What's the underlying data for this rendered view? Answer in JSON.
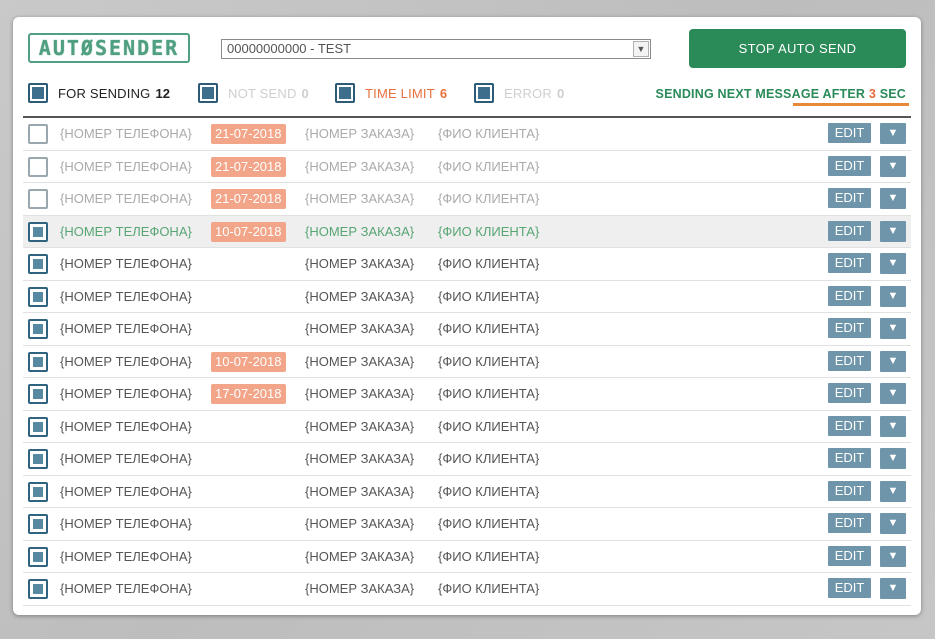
{
  "header": {
    "logo_text": "AUTØSENDER",
    "account_select": "00000000000 - TEST",
    "stop_button": "STOP AUTO SEND"
  },
  "filters": [
    {
      "label": "FOR SENDING",
      "count": "12",
      "color": "#222222",
      "count_color": "#222222"
    },
    {
      "label": "NOT SEND",
      "count": "0",
      "color": "#cfcfcf",
      "count_color": "#cfcfcf"
    },
    {
      "label": "TIME LIMIT",
      "count": "6",
      "color": "#e8703e",
      "count_color": "#e8703e"
    },
    {
      "label": "ERROR",
      "count": "0",
      "color": "#cfcfcf",
      "count_color": "#cfcfcf"
    }
  ],
  "sending_info": {
    "prefix": "SENDING NEXT MESSAGE AFTER",
    "seconds": "3",
    "suffix": "SEC"
  },
  "buttons": {
    "edit": "EDIT",
    "dropdown_icon": "▼"
  },
  "rows": [
    {
      "checked": false,
      "style": "grey",
      "phone": "{НОМЕР ТЕЛЕФОНА}",
      "date": "21-07-2018",
      "order": "{НОМЕР ЗАКАЗА}",
      "client": "{ФИО КЛИЕНТА}"
    },
    {
      "checked": false,
      "style": "grey",
      "phone": "{НОМЕР ТЕЛЕФОНА}",
      "date": "21-07-2018",
      "order": "{НОМЕР ЗАКАЗА}",
      "client": "{ФИО КЛИЕНТА}"
    },
    {
      "checked": false,
      "style": "grey",
      "phone": "{НОМЕР ТЕЛЕФОНА}",
      "date": "21-07-2018",
      "order": "{НОМЕР ЗАКАЗА}",
      "client": "{ФИО КЛИЕНТА}"
    },
    {
      "checked": true,
      "style": "green",
      "phone": "{НОМЕР ТЕЛЕФОНА}",
      "date": "10-07-2018",
      "order": "{НОМЕР ЗАКАЗА}",
      "client": "{ФИО КЛИЕНТА}"
    },
    {
      "checked": true,
      "style": "normal",
      "phone": "{НОМЕР ТЕЛЕФОНА}",
      "date": "",
      "order": "{НОМЕР ЗАКАЗА}",
      "client": "{ФИО КЛИЕНТА}"
    },
    {
      "checked": true,
      "style": "normal",
      "phone": "{НОМЕР ТЕЛЕФОНА}",
      "date": "",
      "order": "{НОМЕР ЗАКАЗА}",
      "client": "{ФИО КЛИЕНТА}"
    },
    {
      "checked": true,
      "style": "normal",
      "phone": "{НОМЕР ТЕЛЕФОНА}",
      "date": "",
      "order": "{НОМЕР ЗАКАЗА}",
      "client": "{ФИО КЛИЕНТА}"
    },
    {
      "checked": true,
      "style": "normal",
      "phone": "{НОМЕР ТЕЛЕФОНА}",
      "date": "10-07-2018",
      "order": "{НОМЕР ЗАКАЗА}",
      "client": "{ФИО КЛИЕНТА}"
    },
    {
      "checked": true,
      "style": "normal",
      "phone": "{НОМЕР ТЕЛЕФОНА}",
      "date": "17-07-2018",
      "order": "{НОМЕР ЗАКАЗА}",
      "client": "{ФИО КЛИЕНТА}"
    },
    {
      "checked": true,
      "style": "normal",
      "phone": "{НОМЕР ТЕЛЕФОНА}",
      "date": "",
      "order": "{НОМЕР ЗАКАЗА}",
      "client": "{ФИО КЛИЕНТА}"
    },
    {
      "checked": true,
      "style": "normal",
      "phone": "{НОМЕР ТЕЛЕФОНА}",
      "date": "",
      "order": "{НОМЕР ЗАКАЗА}",
      "client": "{ФИО КЛИЕНТА}"
    },
    {
      "checked": true,
      "style": "normal",
      "phone": "{НОМЕР ТЕЛЕФОНА}",
      "date": "",
      "order": "{НОМЕР ЗАКАЗА}",
      "client": "{ФИО КЛИЕНТА}"
    },
    {
      "checked": true,
      "style": "normal",
      "phone": "{НОМЕР ТЕЛЕФОНА}",
      "date": "",
      "order": "{НОМЕР ЗАКАЗА}",
      "client": "{ФИО КЛИЕНТА}"
    },
    {
      "checked": true,
      "style": "normal",
      "phone": "{НОМЕР ТЕЛЕФОНА}",
      "date": "",
      "order": "{НОМЕР ЗАКАЗА}",
      "client": "{ФИО КЛИЕНТА}"
    },
    {
      "checked": true,
      "style": "normal",
      "phone": "{НОМЕР ТЕЛЕФОНА}",
      "date": "",
      "order": "{НОМЕР ЗАКАЗА}",
      "client": "{ФИО КЛИЕНТА}"
    }
  ]
}
